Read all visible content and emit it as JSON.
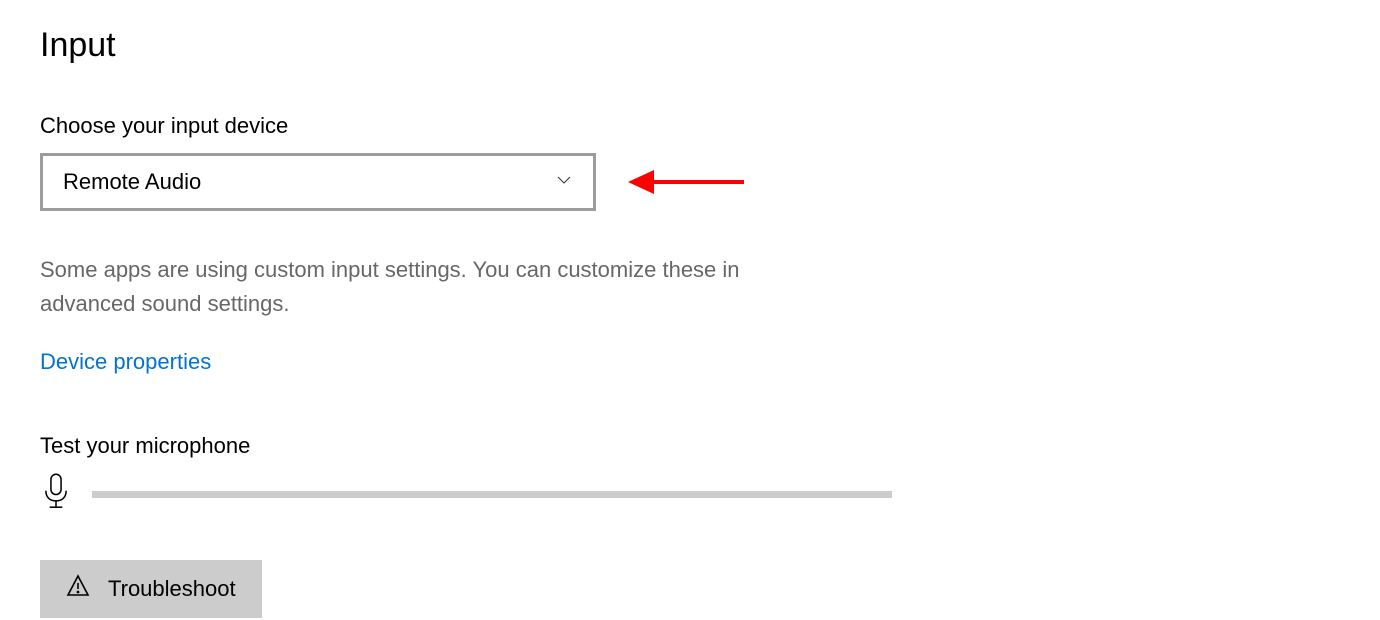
{
  "section": {
    "heading": "Input",
    "choose_label": "Choose your input device",
    "dropdown_value": "Remote Audio",
    "description": "Some apps are using custom input settings. You can customize these in advanced sound settings.",
    "device_properties_link": "Device properties",
    "test_mic_label": "Test your microphone",
    "troubleshoot_label": "Troubleshoot"
  }
}
